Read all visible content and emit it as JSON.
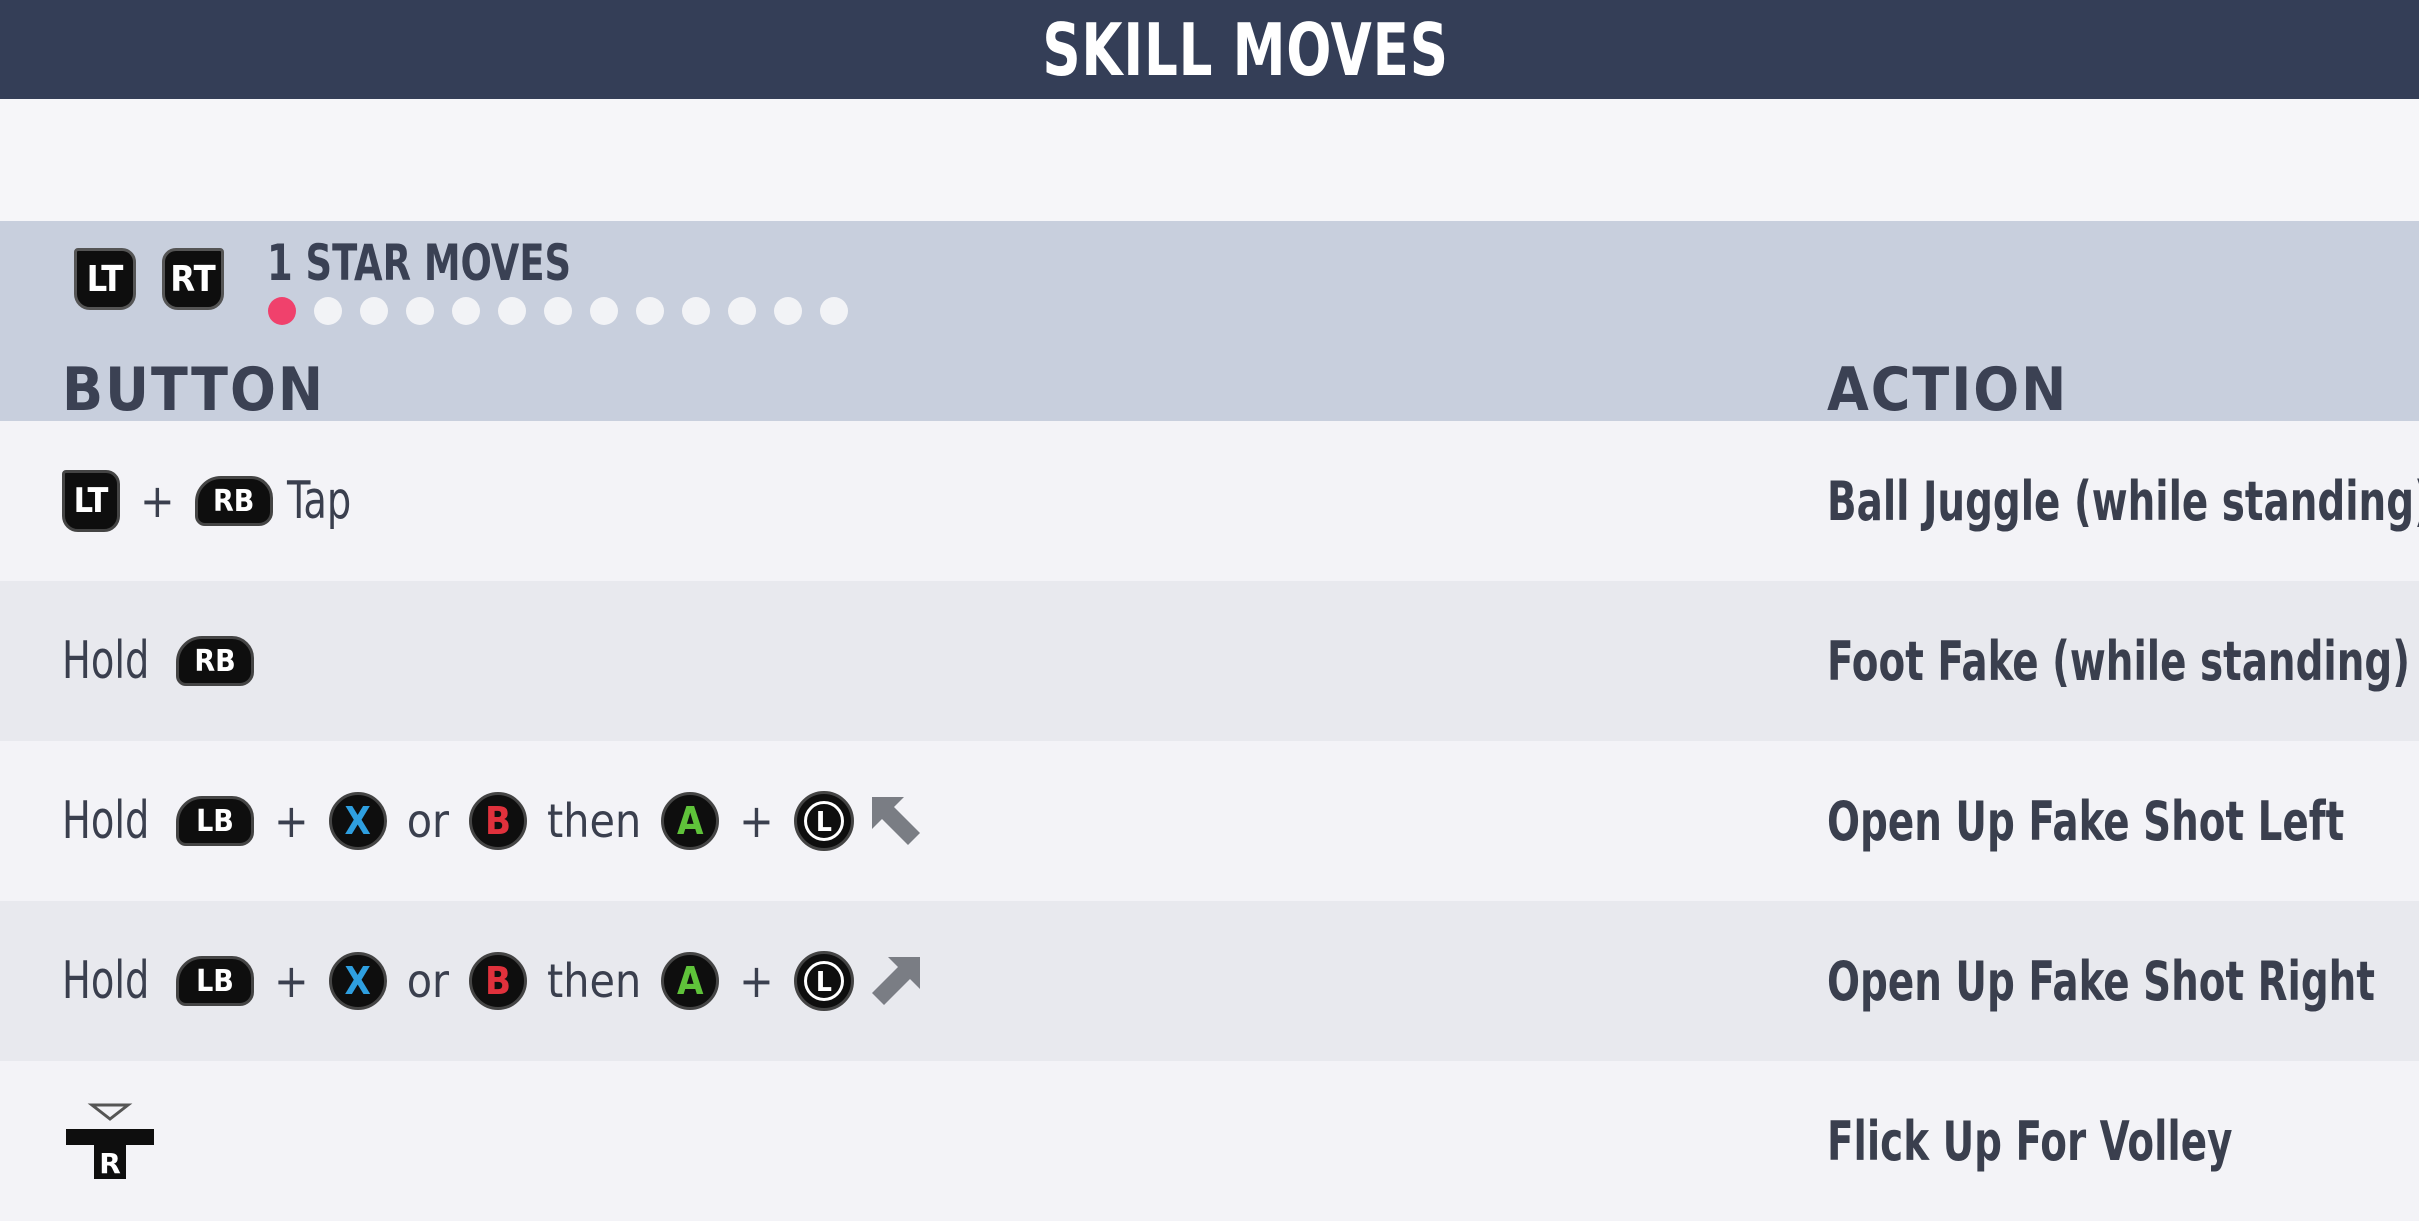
{
  "header": {
    "title": "SKILL MOVES"
  },
  "section": {
    "trigger_left": "LT",
    "trigger_right": "RT",
    "title": "1 STAR MOVES",
    "page_index": 1,
    "page_count": 13
  },
  "columns": {
    "button": "BUTTON",
    "action": "ACTION"
  },
  "rows": [
    {
      "button": {
        "lt": "LT",
        "plus": "+",
        "rb": "RB",
        "suffix": "Tap"
      },
      "action": "Ball Juggle (while standing)"
    },
    {
      "button": {
        "prefix": "Hold",
        "rb": "RB"
      },
      "action": "Foot Fake (while standing)"
    },
    {
      "button": {
        "prefix": "Hold",
        "lb": "LB",
        "plus1": "+",
        "x": "X",
        "or": "or",
        "b": "B",
        "then": "then",
        "a": "A",
        "plus2": "+",
        "stick": "L",
        "direction_icon": "arrow-up-left-icon"
      },
      "action": "Open Up Fake Shot Left"
    },
    {
      "button": {
        "prefix": "Hold",
        "lb": "LB",
        "plus1": "+",
        "x": "X",
        "or": "or",
        "b": "B",
        "then": "then",
        "a": "A",
        "plus2": "+",
        "stick": "L",
        "direction_icon": "arrow-up-right-icon"
      },
      "action": "Open Up Fake Shot Right"
    },
    {
      "button": {
        "stick": "R",
        "direction_icon": "flick-up-icon"
      },
      "action": "Flick Up For Volley"
    }
  ],
  "colors": {
    "header_bg": "#343e57",
    "band_bg": "#c8cfdd",
    "dot_active": "#f0416c",
    "x": "#2e9fe0",
    "b": "#e0313c",
    "a": "#5fc33a"
  }
}
